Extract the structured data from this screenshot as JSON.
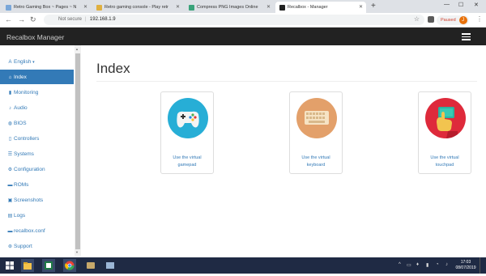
{
  "browser": {
    "tabs": [
      {
        "label": "Retro Gaming Box ~ Pages ~ N",
        "color": "#7aa7d9"
      },
      {
        "label": "Retro gaming console - Play retr",
        "color": "#e0b040"
      },
      {
        "label": "Compress PNG Images Online",
        "color": "#3aa37a"
      },
      {
        "label": "Recalbox - Manager",
        "color": "#222222"
      }
    ],
    "new_tab": "+",
    "security_label": "Not secure",
    "url": "192.168.1.9",
    "profile_status": "Paused",
    "profile_initial": "J"
  },
  "app": {
    "brand": "Recalbox Manager",
    "sidebar": {
      "language": "English",
      "items": [
        {
          "label": "Index",
          "icon": "home-icon",
          "glyph": "⌂"
        },
        {
          "label": "Monitoring",
          "icon": "signal-icon",
          "glyph": "▮"
        },
        {
          "label": "Audio",
          "icon": "volume-icon",
          "glyph": "♪"
        },
        {
          "label": "BIOS",
          "icon": "globe-icon",
          "glyph": "◍"
        },
        {
          "label": "Controllers",
          "icon": "phone-icon",
          "glyph": "▯"
        },
        {
          "label": "Systems",
          "icon": "list-icon",
          "glyph": "☰"
        },
        {
          "label": "Configuration",
          "icon": "gear-icon",
          "glyph": "⚙"
        },
        {
          "label": "ROMs",
          "icon": "hdd-icon",
          "glyph": "▬"
        },
        {
          "label": "Screenshots",
          "icon": "picture-icon",
          "glyph": "▣"
        },
        {
          "label": "Logs",
          "icon": "file-icon",
          "glyph": "▤"
        },
        {
          "label": "recalbox.conf",
          "icon": "hdd-icon",
          "glyph": "▬"
        },
        {
          "label": "Support",
          "icon": "tag-icon",
          "glyph": "⊛"
        }
      ]
    },
    "page_title": "Index",
    "cards": [
      {
        "line1": "Use the virtual",
        "line2": "gamepad",
        "icon": "gamepad-icon",
        "bg": "#27aed6"
      },
      {
        "line1": "Use the virtual",
        "line2": "keyboard",
        "icon": "keyboard-icon",
        "bg": "#e3a06a"
      },
      {
        "line1": "Use the virtual",
        "line2": "touchpad",
        "icon": "touchpad-icon",
        "bg": "#de2a3b"
      }
    ]
  },
  "taskbar": {
    "time": "17:03",
    "date": "08/07/2019"
  }
}
